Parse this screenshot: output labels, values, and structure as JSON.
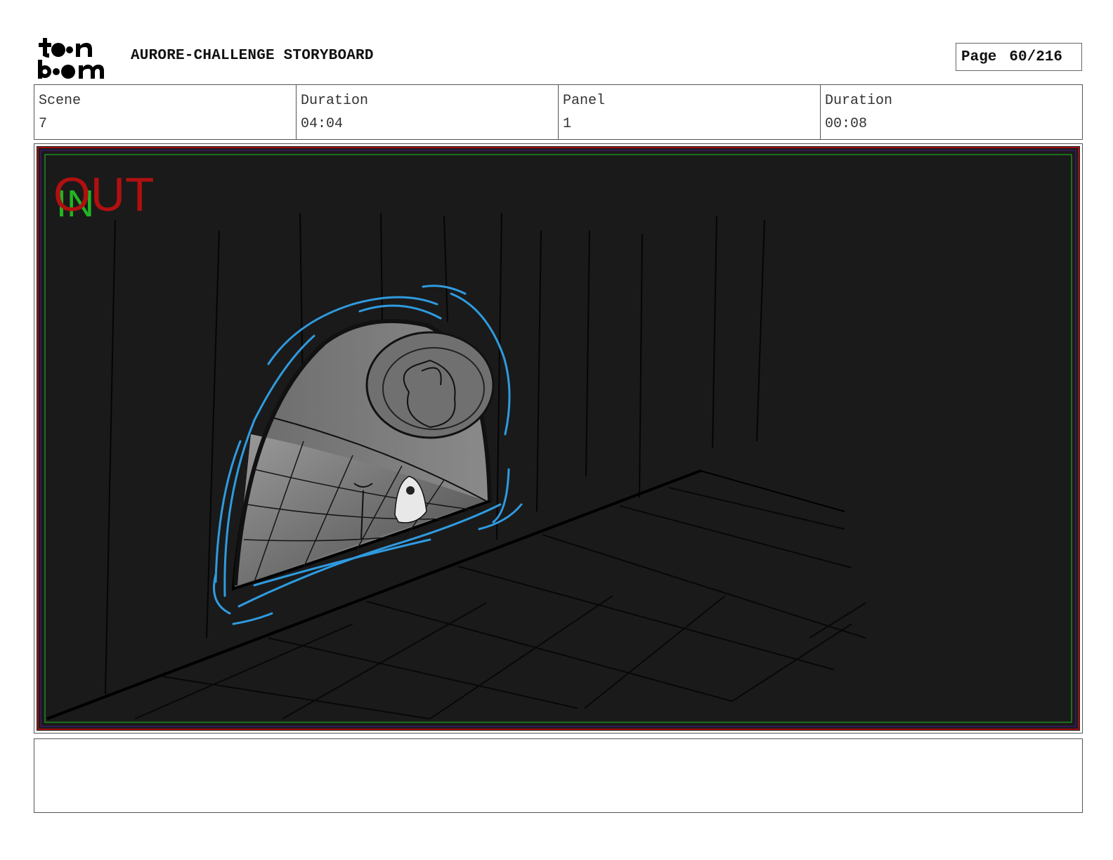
{
  "header": {
    "logo_text": "toon boom",
    "title": "AURORE-CHALLENGE STORYBOARD",
    "page_label": "Page",
    "page_value": "60/216"
  },
  "info": [
    {
      "label": "Scene",
      "value": "7"
    },
    {
      "label": "Duration",
      "value": "04:04"
    },
    {
      "label": "Panel",
      "value": "1"
    },
    {
      "label": "Duration",
      "value": "00:08"
    }
  ],
  "panel": {
    "in_marker": "IN",
    "out_marker": "OUT",
    "colors": {
      "background": "#1a1a1a",
      "portal_glow": "#2f9be0",
      "safe_frame": "#1f8a1f",
      "title_frame": "#a01010",
      "in_marker": "#22b422",
      "out_marker": "#b01010"
    }
  },
  "dialog": {
    "text": ""
  }
}
